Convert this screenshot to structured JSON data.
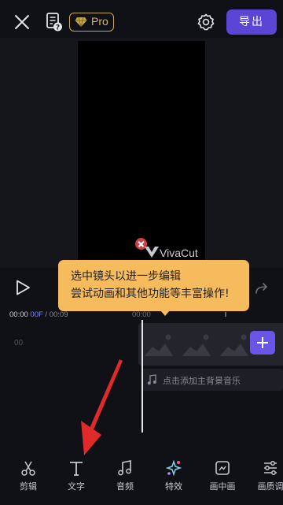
{
  "header": {
    "pro_label": "Pro",
    "export_label": "导出"
  },
  "preview": {
    "watermark_text": "VivaCut"
  },
  "tooltip": {
    "line1": "选中镜头以进一步编辑",
    "line2": "尝试动画和其他功能等丰富操作!"
  },
  "timeline": {
    "current_time": "00:00",
    "current_frame": "00F",
    "separator": " / ",
    "total_time": "00:09",
    "tick_label": "00:00",
    "track_label": "00",
    "music_placeholder": "点击添加主背景音乐"
  },
  "toolbar": {
    "items": [
      {
        "label": "剪辑",
        "icon": "scissors-icon"
      },
      {
        "label": "文字",
        "icon": "text-icon"
      },
      {
        "label": "音频",
        "icon": "music-note-icon"
      },
      {
        "label": "特效",
        "icon": "sparkle-effects-icon"
      },
      {
        "label": "画中画",
        "icon": "picture-in-picture-icon"
      },
      {
        "label": "画质调",
        "icon": "sliders-icon"
      }
    ]
  },
  "colors": {
    "accent": "#5b45d6",
    "tooltip_bg": "#f6bb5d",
    "pro_gold": "#c9a84a",
    "annotation_red": "#e02a2a"
  }
}
